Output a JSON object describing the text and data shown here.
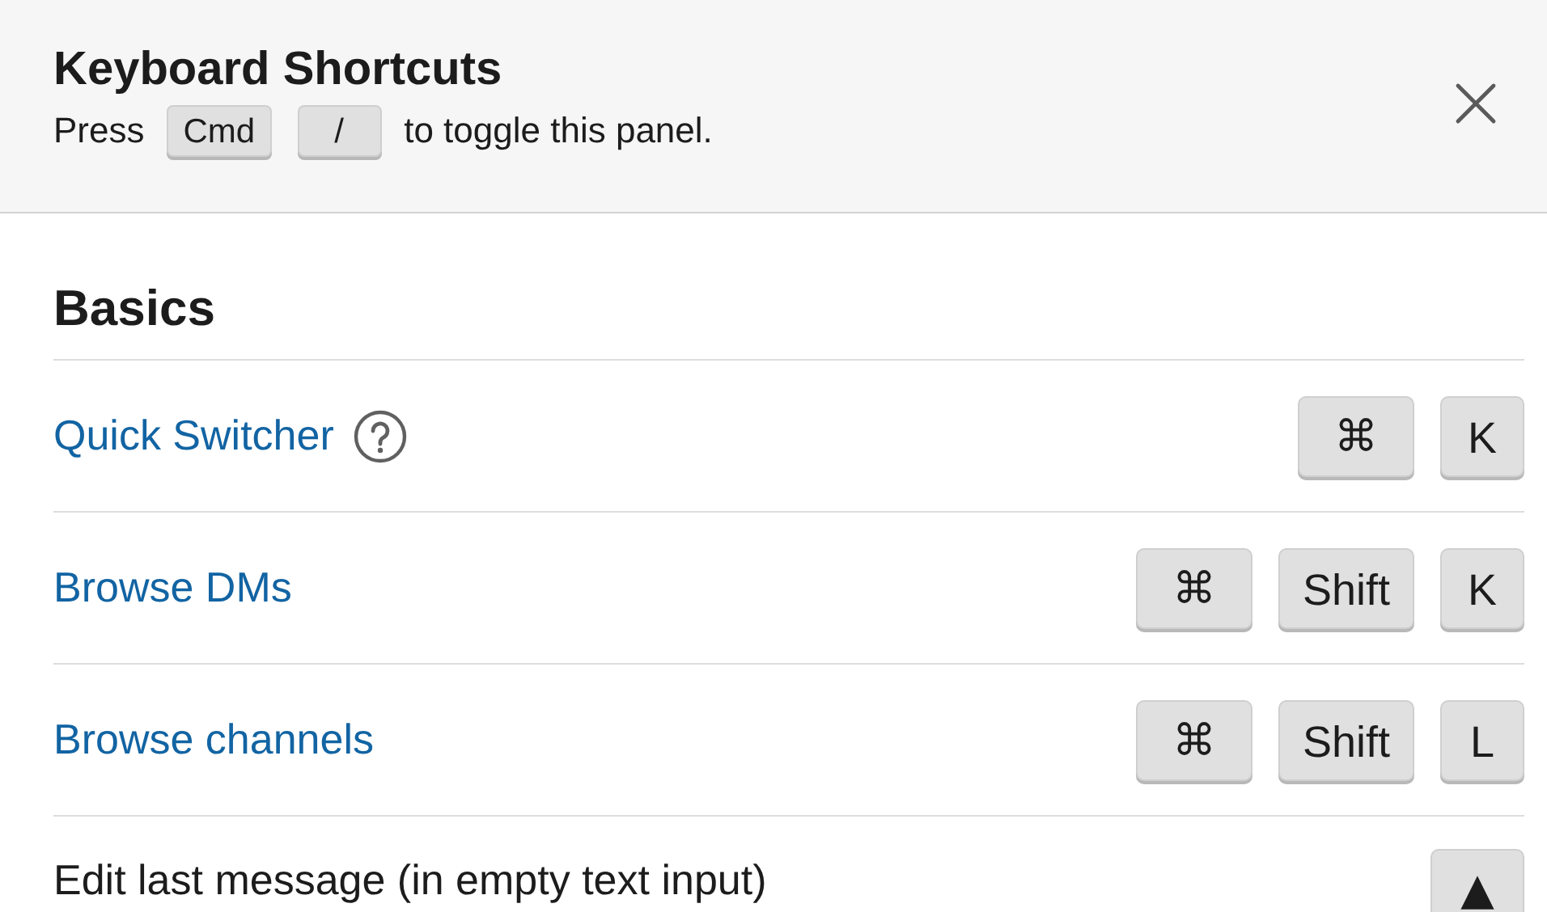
{
  "header": {
    "title": "Keyboard Shortcuts",
    "hint_before": "Press",
    "hint_keys": [
      "Cmd",
      "/"
    ],
    "hint_after": "to toggle this panel."
  },
  "section": {
    "title": "Basics",
    "rows": [
      {
        "label": "Quick Switcher",
        "kind": "link",
        "help": true,
        "keys": [
          "⌘",
          "K"
        ]
      },
      {
        "label": "Browse DMs",
        "kind": "link",
        "help": false,
        "keys": [
          "⌘",
          "Shift",
          "K"
        ]
      },
      {
        "label": "Browse channels",
        "kind": "link",
        "help": false,
        "keys": [
          "⌘",
          "Shift",
          "L"
        ]
      },
      {
        "label": "Edit last message (in empty text input)",
        "kind": "plain",
        "help": false,
        "keys": [
          "▲"
        ]
      }
    ]
  }
}
